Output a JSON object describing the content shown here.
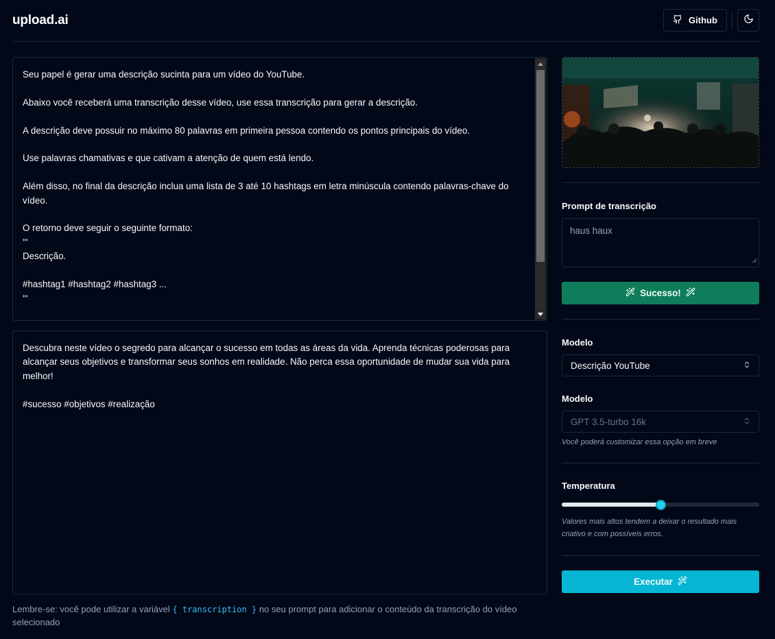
{
  "header": {
    "logo": "upload.ai",
    "github_label": "Github",
    "theme_icon": "moon-icon",
    "github_icon": "github-icon"
  },
  "prompt_editor": {
    "text": "Seu papel é gerar uma descrição sucinta para um vídeo do YouTube.\n\nAbaixo você receberá uma transcrição desse vídeo, use essa transcrição para gerar a descrição.\n\nA descrição deve possuir no máximo 80 palavras em primeira pessoa contendo os pontos principais do vídeo.\n\nUse palavras chamativas e que cativam a atenção de quem está lendo.\n\nAlém disso, no final da descrição inclua uma lista de 3 até 10 hashtags em letra minúscula contendo palavras-chave do vídeo.\n\nO retorno deve seguir o seguinte formato:\n'''\nDescrição.\n\n#hashtag1 #hashtag2 #hashtag3 ...\n'''"
  },
  "result_editor": {
    "text": "Descubra neste vídeo o segredo para alcançar o sucesso em todas as áreas da vida. Aprenda técnicas poderosas para alcançar seus objetivos e transformar seus sonhos em realidade. Não perca essa oportunidade de mudar sua vida para melhor!\n\n#sucesso #objetivos #realização"
  },
  "hint": {
    "before": "Lembre-se: você pode utilizar a variável ",
    "code": "{ transcription }",
    "after": " no seu prompt para adicionar o conteúdo da transcrição do vídeo selecionado"
  },
  "sidebar": {
    "transcription_prompt_label": "Prompt de transcrição",
    "transcription_prompt_value": "haus haux",
    "success_button_label": "Sucesso!",
    "template_label": "Modelo",
    "template_value": "Descrição YouTube",
    "model_label": "Modelo",
    "model_value": "GPT 3.5-turbo 16k",
    "model_note": "Você poderá customizar essa opção em breve",
    "temperature_label": "Temperatura",
    "temperature_value": 0.5,
    "temperature_note": "Valores mais altos tendem a deixar o resultado mais criativo e com possíveis erros.",
    "execute_label": "Executar"
  },
  "colors": {
    "background": "#020817",
    "border": "#1e293b",
    "success": "#0f7d5c",
    "accent": "#06b6d4"
  }
}
